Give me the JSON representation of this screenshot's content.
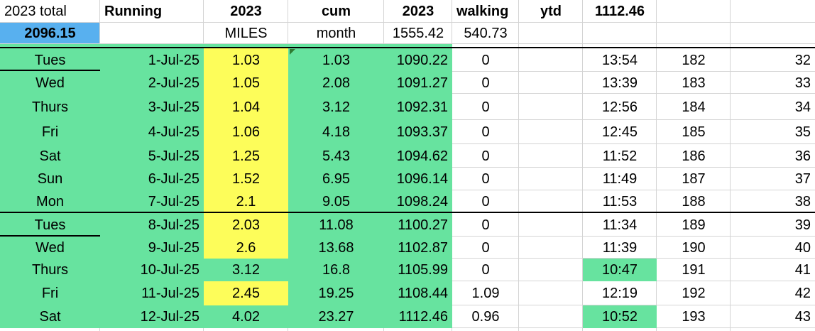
{
  "colors": {
    "green": "#67e39f",
    "yellow": "#fdfd5a",
    "blue": "#58b0ef",
    "grid": "#d4d4d4"
  },
  "header1": [
    "2023 total",
    "Running",
    "2023",
    "cum",
    "2023",
    "walking",
    "ytd",
    "1112.46",
    "",
    ""
  ],
  "header2": [
    "2096.15",
    "",
    "MILES",
    "month",
    "1555.42",
    "540.73",
    "",
    "",
    "",
    ""
  ],
  "rows": [
    {
      "day": "Tues",
      "date": "1-Jul-25",
      "miles": "1.03",
      "cum": "1.03",
      "total": "1090.22",
      "walking": "0",
      "ytd": "",
      "pace": "13:54",
      "count": "182",
      "streak": "32"
    },
    {
      "day": "Wed",
      "date": "2-Jul-25",
      "miles": "1.05",
      "cum": "2.08",
      "total": "1091.27",
      "walking": "0",
      "ytd": "",
      "pace": "13:39",
      "count": "183",
      "streak": "33"
    },
    {
      "day": "Thurs",
      "date": "3-Jul-25",
      "miles": "1.04",
      "cum": "3.12",
      "total": "1092.31",
      "walking": "0",
      "ytd": "",
      "pace": "12:56",
      "count": "184",
      "streak": "34"
    },
    {
      "day": "Fri",
      "date": "4-Jul-25",
      "miles": "1.06",
      "cum": "4.18",
      "total": "1093.37",
      "walking": "0",
      "ytd": "",
      "pace": "12:45",
      "count": "185",
      "streak": "35"
    },
    {
      "day": "Sat",
      "date": "5-Jul-25",
      "miles": "1.25",
      "cum": "5.43",
      "total": "1094.62",
      "walking": "0",
      "ytd": "",
      "pace": "11:52",
      "count": "186",
      "streak": "36"
    },
    {
      "day": "Sun",
      "date": "6-Jul-25",
      "miles": "1.52",
      "cum": "6.95",
      "total": "1096.14",
      "walking": "0",
      "ytd": "",
      "pace": "11:49",
      "count": "187",
      "streak": "37"
    },
    {
      "day": "Mon",
      "date": "7-Jul-25",
      "miles": "2.1",
      "cum": "9.05",
      "total": "1098.24",
      "walking": "0",
      "ytd": "",
      "pace": "11:53",
      "count": "188",
      "streak": "38"
    },
    {
      "day": "Tues",
      "date": "8-Jul-25",
      "miles": "2.03",
      "cum": "11.08",
      "total": "1100.27",
      "walking": "0",
      "ytd": "",
      "pace": "11:34",
      "count": "189",
      "streak": "39"
    },
    {
      "day": "Wed",
      "date": "9-Jul-25",
      "miles": "2.6",
      "cum": "13.68",
      "total": "1102.87",
      "walking": "0",
      "ytd": "",
      "pace": "11:39",
      "count": "190",
      "streak": "40"
    },
    {
      "day": "Thurs",
      "date": "10-Jul-25",
      "miles": "3.12",
      "cum": "16.8",
      "total": "1105.99",
      "walking": "0",
      "ytd": "",
      "pace": "10:47",
      "count": "191",
      "streak": "41"
    },
    {
      "day": "Fri",
      "date": "11-Jul-25",
      "miles": "2.45",
      "cum": "19.25",
      "total": "1108.44",
      "walking": "1.09",
      "ytd": "",
      "pace": "12:19",
      "count": "192",
      "streak": "42"
    },
    {
      "day": "Sat",
      "date": "12-Jul-25",
      "miles": "4.02",
      "cum": "23.27",
      "total": "1112.46",
      "walking": "0.96",
      "ytd": "",
      "pace": "10:52",
      "count": "193",
      "streak": "43"
    }
  ]
}
